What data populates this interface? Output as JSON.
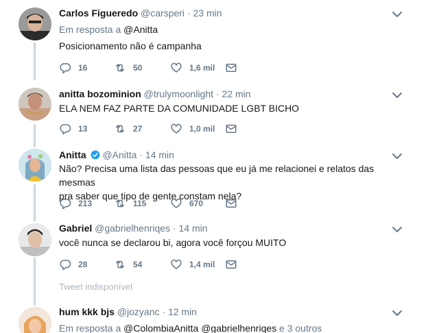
{
  "tweets": [
    {
      "name": "Carlos Figueredo",
      "handle": "@carsperi",
      "dot": "·",
      "time": "23 min",
      "reply_prefix": "Em resposta a",
      "reply_target": "@Anitta",
      "text": "Posicionamento não é campanha",
      "replies": "16",
      "retweets": "50",
      "likes": "1,6 mil"
    },
    {
      "name": "anitta bozominion",
      "handle": "@trulymoonlight",
      "dot": "·",
      "time": "22 min",
      "text": "ELA NEM FAZ PARTE DA COMUNIDADE LGBT BICHO",
      "replies": "13",
      "retweets": "27",
      "likes": "1,0 mil"
    },
    {
      "name": "Anitta",
      "handle": "@Anitta",
      "dot": "·",
      "time": "14 min",
      "verified": true,
      "text_line1": "Não? Precisa uma lista das pessoas que eu já me relacionei e relatos das mesmas",
      "text_line2": "pra saber que tipo de gente constam nela?",
      "replies": "213",
      "retweets": "115",
      "likes": "670"
    },
    {
      "name": "Gabriel",
      "handle": "@gabrielhenriqes",
      "dot": "·",
      "time": "14 min",
      "text": "você nunca se declarou bi, agora você forçou MUITO",
      "replies": "28",
      "retweets": "54",
      "likes": "1,4 mil"
    },
    {
      "name": "hum kkk bjs",
      "handle": "@jozyanc",
      "dot": "·",
      "time": "12 min",
      "reply_prefix": "Em resposta a",
      "reply_target": "@ColombiaAnitta @gabrielhenriqes",
      "reply_suffix": "e 3 outros"
    }
  ],
  "unavailable_text": "Tweet indisponível",
  "colors": {
    "text": "#14171a",
    "secondary": "#657786",
    "thread": "#ccd6dd",
    "verified": "#1da1f2",
    "muted": "#aab8c2"
  },
  "icons": [
    "reply-icon",
    "retweet-icon",
    "like-icon",
    "message-icon",
    "chevron-down-icon",
    "verified-badge-icon"
  ]
}
